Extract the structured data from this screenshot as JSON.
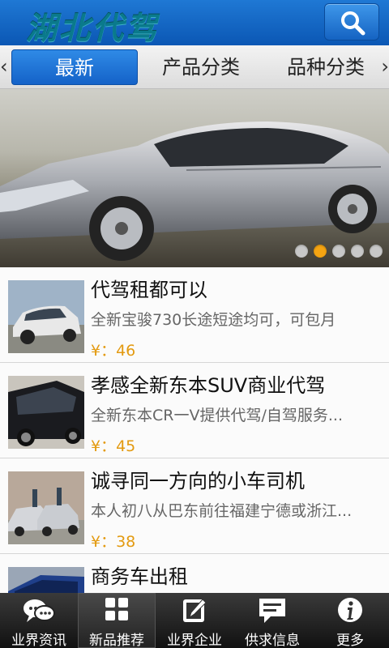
{
  "header": {
    "logo_text": "湖北代驾",
    "search_icon": "search-icon"
  },
  "tabs": [
    {
      "label": "最新",
      "active": true
    },
    {
      "label": "产品分类",
      "active": false
    },
    {
      "label": "品种分类",
      "active": false
    }
  ],
  "banner": {
    "slide_count": 5,
    "active_slide": 2
  },
  "list": [
    {
      "title": "代驾租都可以",
      "desc": "全新宝骏730长途短途均可，可包月",
      "price": "¥：46"
    },
    {
      "title": "孝感全新东本SUV商业代驾",
      "desc": "全新东本CR一V提供代驾/自驾服务...",
      "price": "¥：45"
    },
    {
      "title": "诚寻同一方向的小车司机",
      "desc": "本人初八从巴东前往福建宁德或浙江...",
      "price": "¥：38"
    },
    {
      "title": "商务车出租",
      "desc": "",
      "price": ""
    }
  ],
  "bottom_nav": [
    {
      "label": "业界资讯",
      "icon": "chat-bubbles-icon",
      "active": false
    },
    {
      "label": "新品推荐",
      "icon": "grid-icon",
      "active": true
    },
    {
      "label": "业界企业",
      "icon": "edit-icon",
      "active": false
    },
    {
      "label": "供求信息",
      "icon": "message-icon",
      "active": false
    },
    {
      "label": "更多",
      "icon": "info-icon",
      "active": false
    }
  ],
  "colors": {
    "header_blue": "#1565c0",
    "price_orange": "#e39a10",
    "active_dot": "#f5a412"
  }
}
